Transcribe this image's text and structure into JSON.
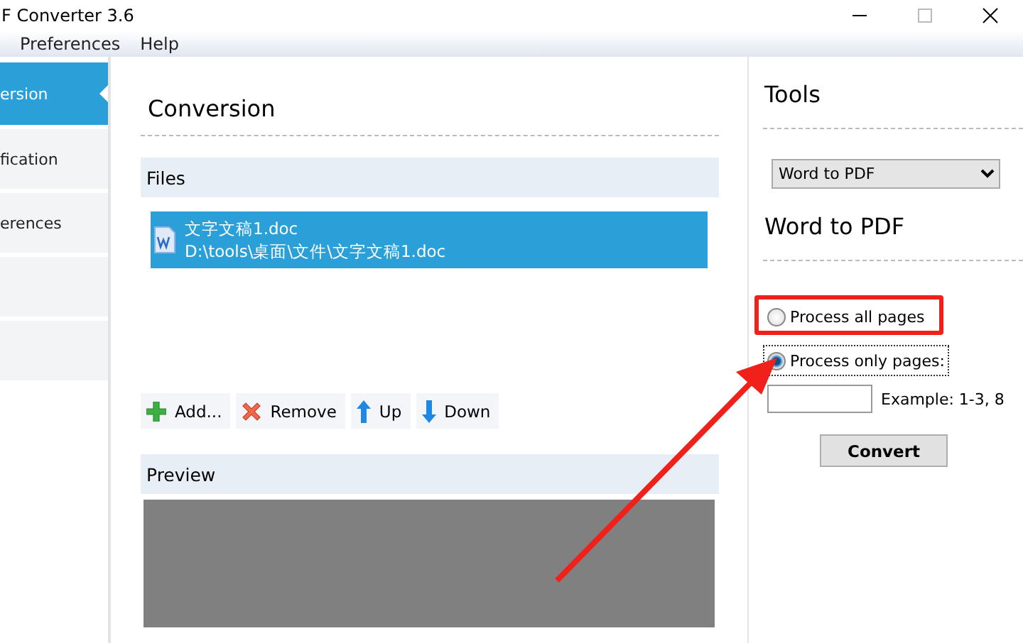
{
  "window": {
    "title": "F Converter 3.6"
  },
  "menu": [
    "Preferences",
    "Help"
  ],
  "sidebar": {
    "items": [
      {
        "label": "ersion",
        "selected": true
      },
      {
        "label": "fication",
        "selected": false
      },
      {
        "label": "erences",
        "selected": false
      },
      {
        "selected": false
      },
      {
        "selected": false
      }
    ]
  },
  "conversion": {
    "title": "Conversion",
    "files_header": "Files",
    "files": [
      {
        "name": "文字文稿1.doc",
        "path": "D:\\tools\\桌面\\文件\\文字文稿1.doc",
        "selected": true
      }
    ],
    "buttons": [
      {
        "kind": "add",
        "label": "Add..."
      },
      {
        "kind": "remove",
        "label": "Remove"
      },
      {
        "kind": "up",
        "label": "Up"
      },
      {
        "kind": "down",
        "label": "Down"
      }
    ],
    "preview_header": "Preview"
  },
  "tools": {
    "title": "Tools",
    "tool_select": "Word to PDF",
    "section_title": "Word to PDF",
    "options": [
      {
        "label": "Process all pages",
        "selected": false,
        "highlighted": true
      },
      {
        "label": "Process only pages:",
        "selected": true,
        "highlighted": false
      }
    ],
    "example": "Example: 1-3, 8",
    "convert_button": "Convert"
  }
}
